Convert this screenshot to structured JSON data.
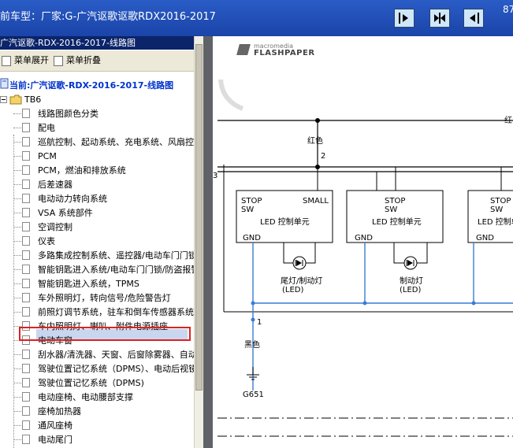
{
  "titlebar": {
    "title": "前车型：厂家:G-广汽讴歌讴歌RDX2016-2017",
    "num": "87"
  },
  "left": {
    "header": "广汽讴歌-RDX-2016-2017-线路图",
    "expand": "菜单展开",
    "collapse": "菜单折叠",
    "current": "当前:广汽讴歌-RDX-2016-2017-线路图",
    "folder": "TB6",
    "items": [
      "线路图颜色分类",
      "配电",
      "巡航控制、起动系统、充电系统、风扇控",
      "PCM",
      "PCM，燃油和排放系统",
      "后差速器",
      "电动动力转向系统",
      "VSA 系统部件",
      "空调控制",
      "仪表",
      "多路集成控制系统、遥控器/电动车门门锁",
      "智能钥匙进入系统/电动车门门锁/防盗报警系统",
      "智能钥匙进入系统，TPMS",
      "车外照明灯，转向信号/危险警告灯",
      "前照灯调节系统，驻车和倒车传感器系统",
      "车内照明灯、喇叭、附件电源插座",
      "电动车窗",
      "刮水器/清洗器、天窗、后窗除雾器、自动",
      "驾驶位置记忆系统（DPMS）、电动后视镜",
      "驾驶位置记忆系统（DPMS)",
      "电动座椅、电动腰部支撑",
      "座椅加热器",
      "通风座椅",
      "电动尾门"
    ]
  },
  "diagram": {
    "logo_top": "macromedia",
    "logo_bottom": "FLASHPAPER",
    "wire_red": "红色",
    "wire_red_top": "红",
    "wire_num2": "2",
    "wire_num3": "3",
    "stop": "STOP",
    "sw": "SW",
    "small": "SMALL",
    "led_unit": "LED 控制单元",
    "gnd": "GND",
    "lamp1_label1": "尾灯/制动灯",
    "lamp1_label2": "(LED)",
    "lamp2_label1": "制动灯",
    "lamp2_label2": "(LED)",
    "wire_num1": "1",
    "wire_black": "黑色",
    "ground": "G651"
  },
  "colors": {
    "titlebar": "#1f4fb5",
    "tree_highlight_border": "#e02020",
    "wire_blue": "#3a7cd6"
  }
}
